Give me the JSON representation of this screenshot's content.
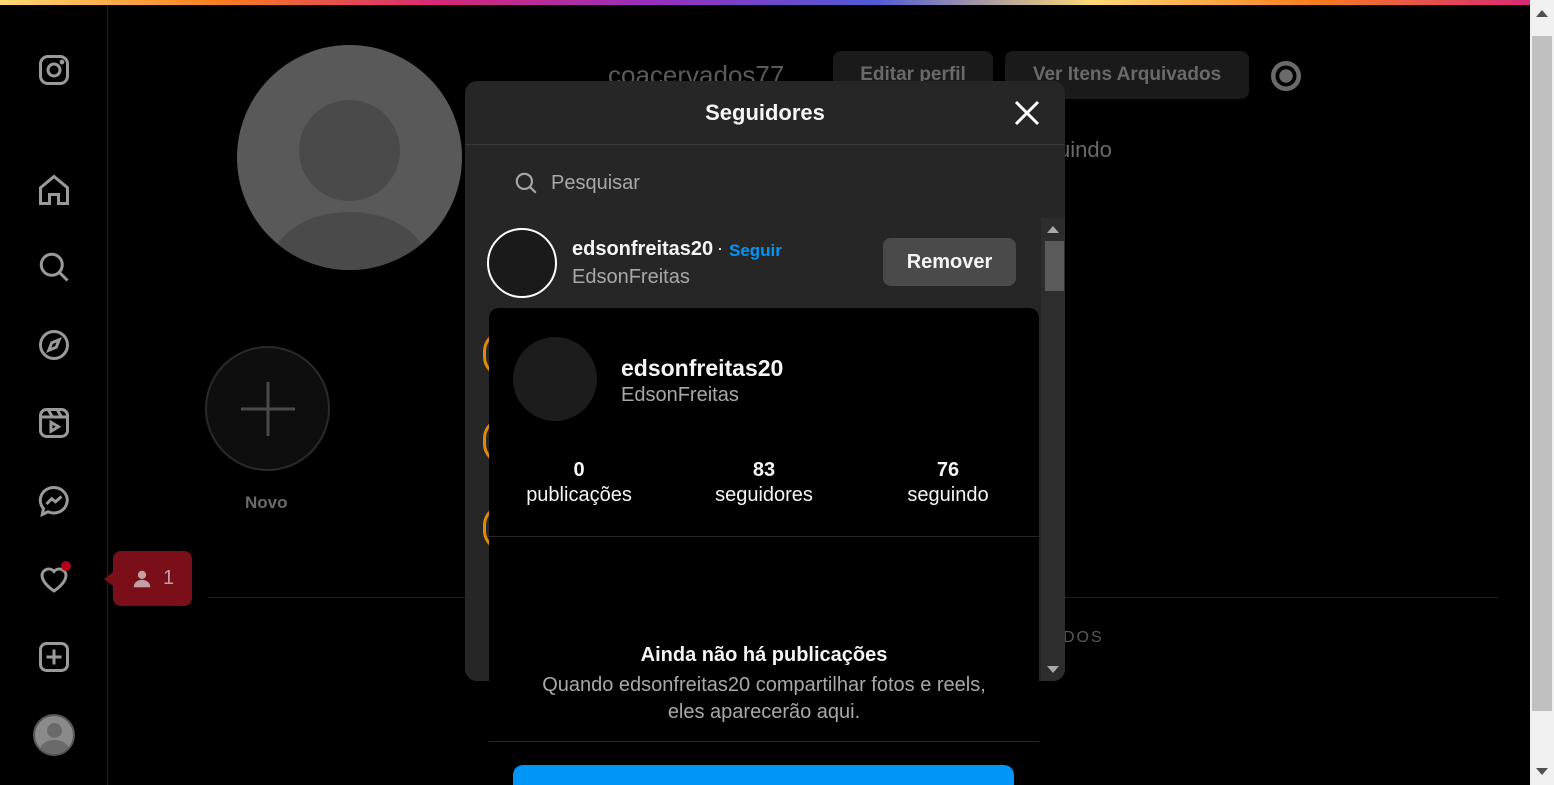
{
  "profile": {
    "username": "coacervados77",
    "edit_button": "Editar perfil",
    "archive_button": "Ver Itens Arquivados",
    "following_partial": "uindo",
    "new_highlight_label": "Novo",
    "tab_partial": "DOS"
  },
  "notification_badge": {
    "count": "1"
  },
  "modal": {
    "title": "Seguidores",
    "search_placeholder": "Pesquisar",
    "followers": [
      {
        "username": "edsonfreitas20",
        "separator": "·",
        "follow_label": "Seguir",
        "full_name": "EdsonFreitas",
        "remove_label": "Remover"
      }
    ]
  },
  "hover_card": {
    "username": "edsonfreitas20",
    "full_name": "EdsonFreitas",
    "stats": [
      {
        "value": "0",
        "label": "publicações"
      },
      {
        "value": "83",
        "label": "seguidores"
      },
      {
        "value": "76",
        "label": "seguindo"
      }
    ],
    "empty_title": "Ainda não há publicações",
    "empty_line1": "Quando edsonfreitas20 compartilhar fotos e reels,",
    "empty_line2": "eles aparecerão aqui."
  },
  "colors": {
    "accent_blue": "#0095f6",
    "notification_red": "#b3001b",
    "modal_bg": "#262626"
  }
}
